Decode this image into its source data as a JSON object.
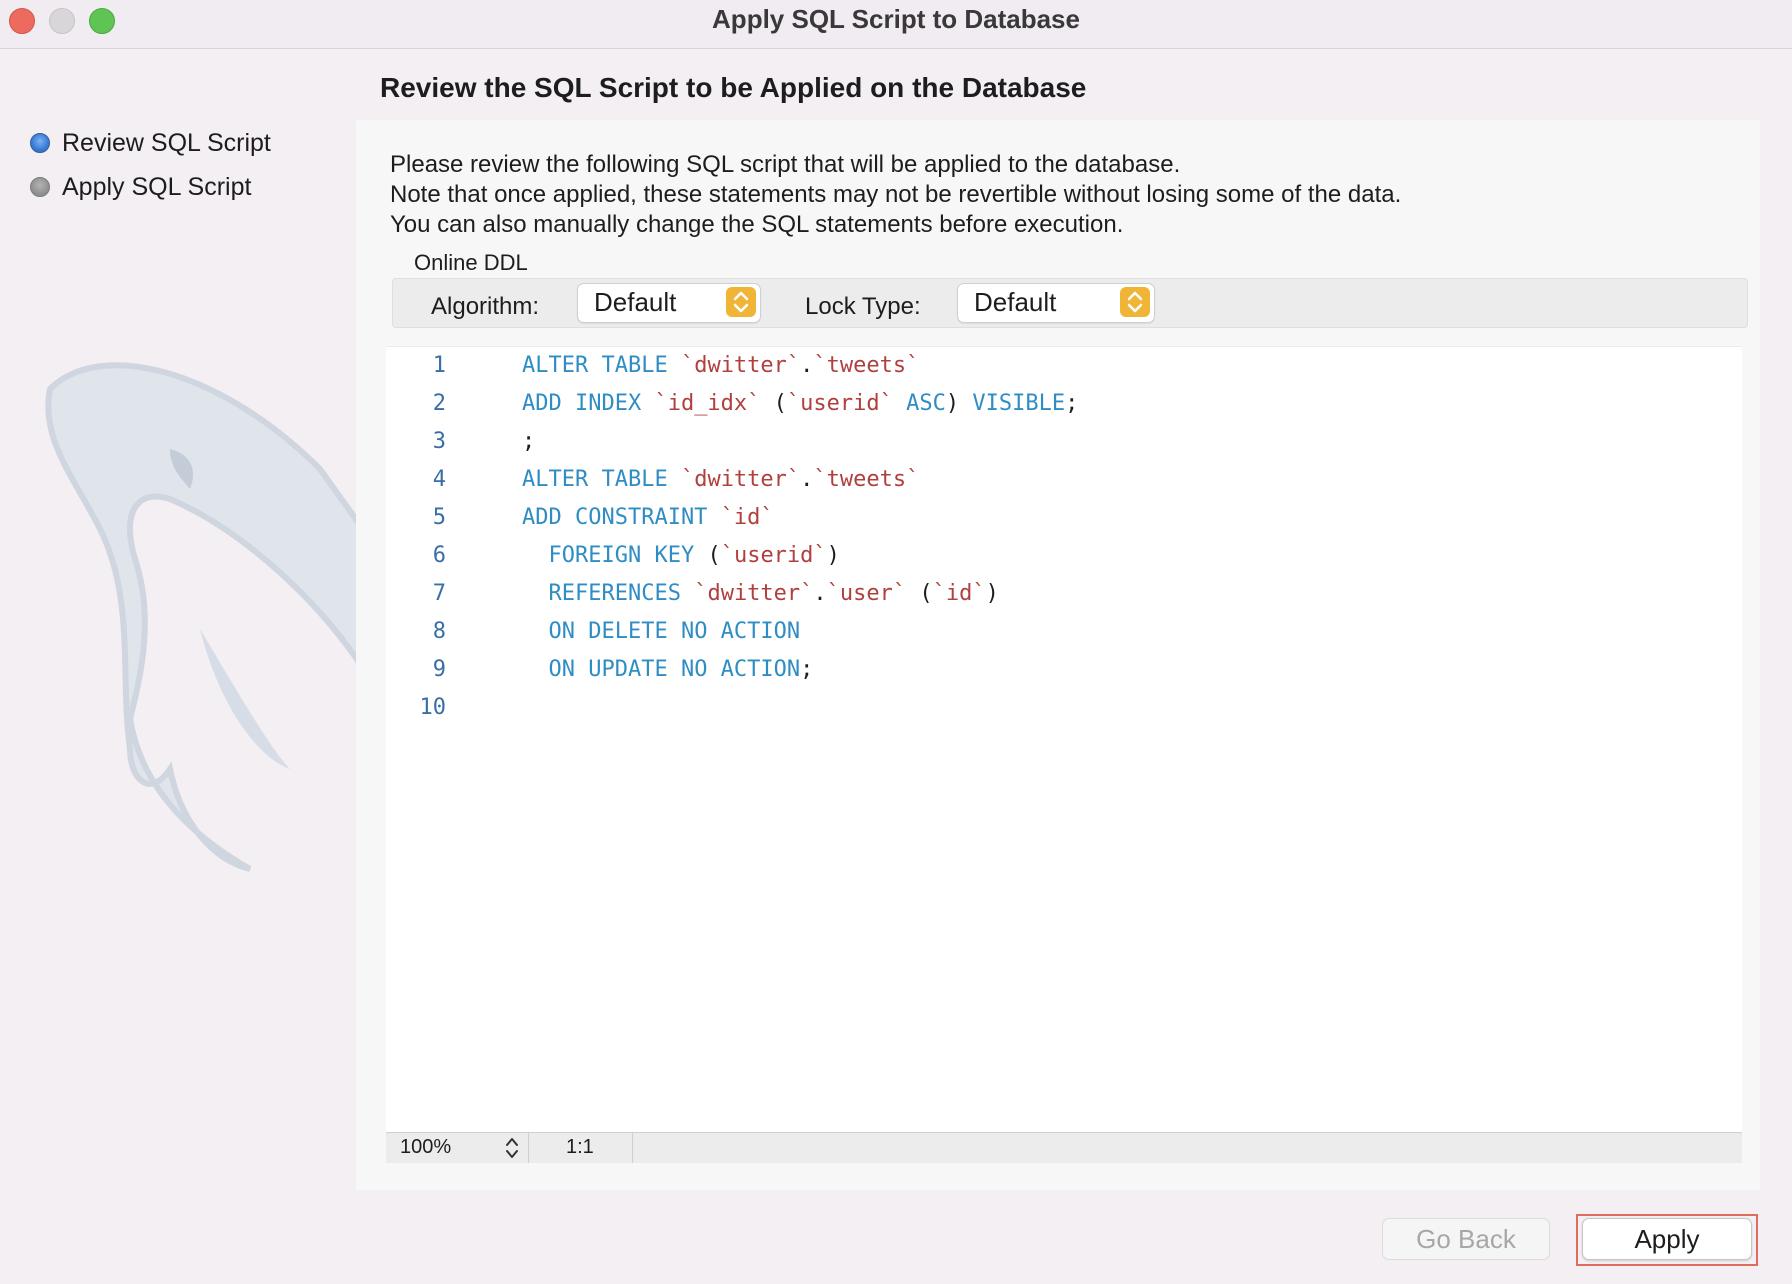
{
  "window": {
    "title": "Apply SQL Script to Database"
  },
  "sidebar": {
    "steps": [
      {
        "label": "Review SQL Script",
        "state": "active"
      },
      {
        "label": "Apply SQL Script",
        "state": "pending"
      }
    ]
  },
  "main": {
    "heading": "Review the SQL Script to be Applied on the Database",
    "description": [
      "Please review the following SQL script that will be applied to the database.",
      "Note that once applied, these statements may not be revertible without losing some of the data.",
      "You can also manually change the SQL statements before execution."
    ],
    "online_ddl": {
      "group_label": "Online DDL",
      "algorithm_label": "Algorithm:",
      "algorithm_value": "Default",
      "lock_type_label": "Lock Type:",
      "lock_type_value": "Default"
    },
    "editor": {
      "lines": [
        {
          "n": "1",
          "tokens": [
            [
              "kw",
              "ALTER TABLE "
            ],
            [
              "id",
              "`dwitter`"
            ],
            [
              "pl",
              "."
            ],
            [
              "id",
              "`tweets`"
            ]
          ]
        },
        {
          "n": "2",
          "tokens": [
            [
              "kw",
              "ADD INDEX "
            ],
            [
              "id",
              "`id_idx`"
            ],
            [
              "pl",
              " ("
            ],
            [
              "id",
              "`userid`"
            ],
            [
              "kw",
              " ASC"
            ],
            [
              "pl",
              ") "
            ],
            [
              "kw",
              "VISIBLE"
            ],
            [
              "pl",
              ";"
            ]
          ]
        },
        {
          "n": "3",
          "tokens": [
            [
              "pl",
              ";"
            ]
          ]
        },
        {
          "n": "4",
          "tokens": [
            [
              "kw",
              "ALTER TABLE "
            ],
            [
              "id",
              "`dwitter`"
            ],
            [
              "pl",
              "."
            ],
            [
              "id",
              "`tweets`"
            ]
          ]
        },
        {
          "n": "5",
          "tokens": [
            [
              "kw",
              "ADD CONSTRAINT "
            ],
            [
              "id",
              "`id`"
            ]
          ]
        },
        {
          "n": "6",
          "tokens": [
            [
              "pl",
              "  "
            ],
            [
              "kw",
              "FOREIGN KEY "
            ],
            [
              "pl",
              "("
            ],
            [
              "id",
              "`userid`"
            ],
            [
              "pl",
              ")"
            ]
          ]
        },
        {
          "n": "7",
          "tokens": [
            [
              "pl",
              "  "
            ],
            [
              "kw",
              "REFERENCES "
            ],
            [
              "id",
              "`dwitter`"
            ],
            [
              "pl",
              "."
            ],
            [
              "id",
              "`user`"
            ],
            [
              "pl",
              " ("
            ],
            [
              "id",
              "`id`"
            ],
            [
              "pl",
              ")"
            ]
          ]
        },
        {
          "n": "8",
          "tokens": [
            [
              "pl",
              "  "
            ],
            [
              "kw",
              "ON DELETE NO ACTION"
            ]
          ]
        },
        {
          "n": "9",
          "tokens": [
            [
              "pl",
              "  "
            ],
            [
              "kw",
              "ON UPDATE NO ACTION"
            ],
            [
              "pl",
              ";"
            ]
          ]
        },
        {
          "n": "10",
          "tokens": []
        }
      ],
      "zoom": "100%",
      "cursor_position": "1:1"
    }
  },
  "footer": {
    "back_label": "Go Back",
    "apply_label": "Apply"
  },
  "colors": {
    "keyword": "#2f8dc4",
    "identifier": "#b0403d",
    "line_number": "#3a6fa5",
    "select_accent": "#f0b436",
    "highlight_outline": "#e06b5f"
  }
}
